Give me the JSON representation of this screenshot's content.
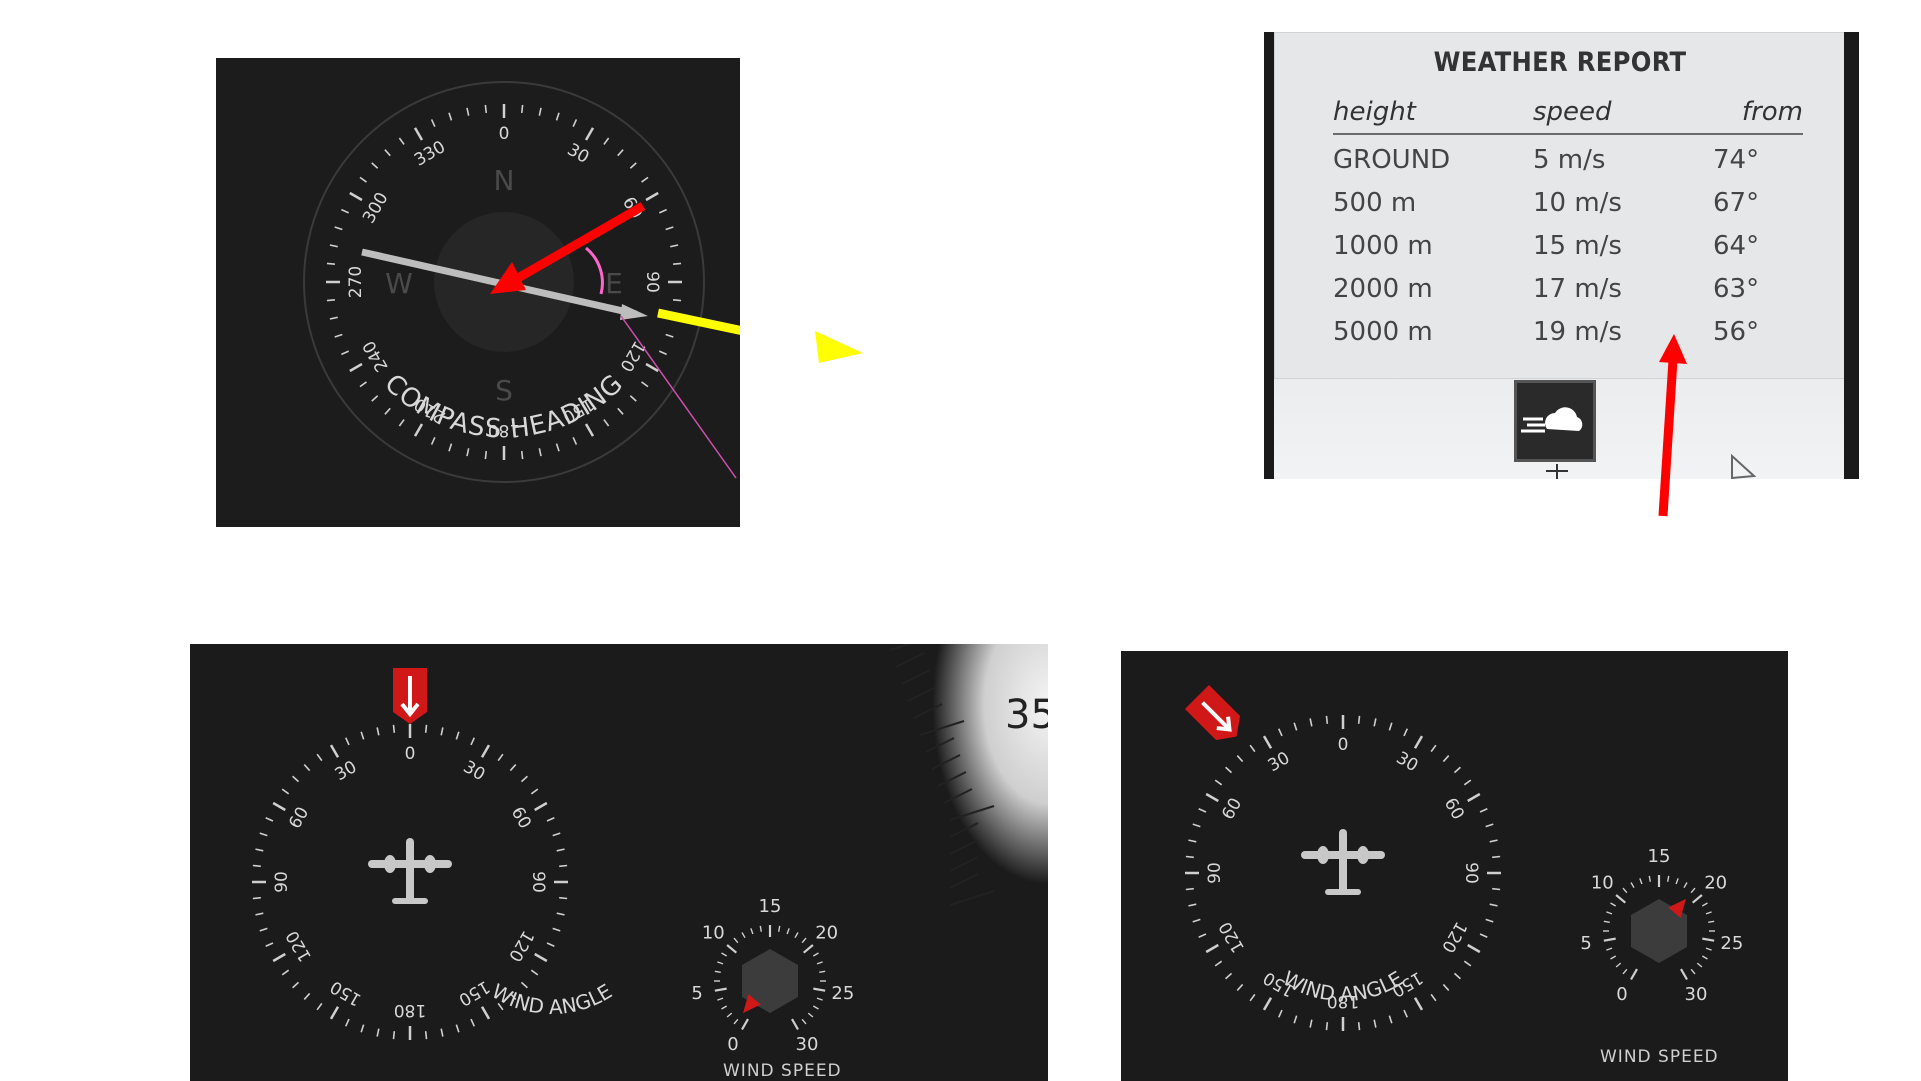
{
  "compass": {
    "label": "COMPASS HEADING",
    "cardinals": [
      "N",
      "E",
      "S",
      "W"
    ],
    "degree_labels": [
      "0",
      "30",
      "60",
      "90",
      "120",
      "150",
      "180",
      "210",
      "240",
      "270",
      "300",
      "330"
    ]
  },
  "weather": {
    "title": "WEATHER REPORT",
    "columns": [
      "height",
      "speed",
      "from"
    ],
    "rows": [
      [
        "GROUND",
        "5 m/s",
        "74°"
      ],
      [
        "500 m",
        "10 m/s",
        "67°"
      ],
      [
        "1000 m",
        "15 m/s",
        "64°"
      ],
      [
        "2000 m",
        "17 m/s",
        "63°"
      ],
      [
        "5000 m",
        "19 m/s",
        "56°"
      ]
    ]
  },
  "wind_gauge_1": {
    "angle_label": "WIND ANGLE",
    "angle_ticks": [
      "0",
      "30",
      "60",
      "90",
      "120",
      "150",
      "180",
      "150",
      "120",
      "90",
      "60",
      "30"
    ],
    "speed_label": "WIND SPEED",
    "speed_ticks": [
      "0",
      "5",
      "10",
      "15",
      "20",
      "25",
      "30"
    ],
    "side_number": "35",
    "speed_value": 1
  },
  "wind_gauge_2": {
    "angle_label": "WIND ANGLE",
    "angle_ticks": [
      "0",
      "30",
      "60",
      "90",
      "120",
      "150",
      "180",
      "150",
      "120",
      "90",
      "60",
      "30"
    ],
    "speed_label": "WIND SPEED",
    "speed_ticks": [
      "0",
      "5",
      "10",
      "15",
      "20",
      "25",
      "30"
    ],
    "speed_value": 19
  },
  "colors": {
    "panel_bg": "#1c1c1c",
    "dial_text": "#d8d8d8",
    "red_marker": "#d01818",
    "yellow_arrow": "#ffff00",
    "magenta_arc": "#ff66cc"
  }
}
